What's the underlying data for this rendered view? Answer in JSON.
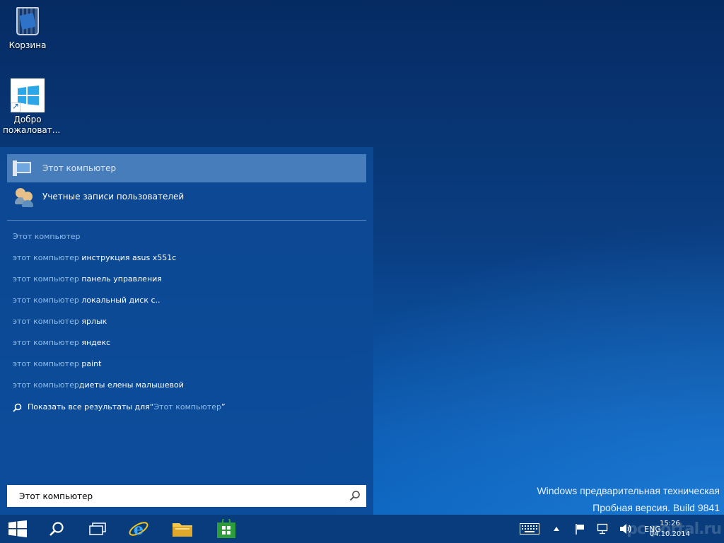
{
  "desktop": {
    "icons": [
      {
        "label": "Корзина"
      },
      {
        "label": "Добро пожаловат..."
      }
    ]
  },
  "search_panel": {
    "best_results": [
      {
        "label": "Этот компьютер",
        "selected": true,
        "icon": "computer-icon"
      },
      {
        "label": "Учетные записи пользователей",
        "selected": false,
        "icon": "user-accounts-icon"
      }
    ],
    "suggestions": [
      {
        "query": "Этот компьютер",
        "rest": ""
      },
      {
        "query": "этот компьютер",
        "rest": " инструкция asus x551c"
      },
      {
        "query": "этот компьютер",
        "rest": " панель управления"
      },
      {
        "query": "этот компьютер",
        "rest": " локальный диск с.."
      },
      {
        "query": "этот компьютер",
        "rest": " ярлык"
      },
      {
        "query": "этот компьютер",
        "rest": " яндекс"
      },
      {
        "query": "этот компьютер",
        "rest": " paint"
      },
      {
        "query": "этот компьютер",
        "rest": "диеты елены малышевой"
      }
    ],
    "show_all": {
      "prefix": "Показать все результаты для ",
      "open_quote": "“",
      "term": "Этот компьютер",
      "close_quote": "”"
    },
    "search_box": {
      "value": "Этот компьютер"
    }
  },
  "watermark": {
    "line1": "Windows предварительная техническая",
    "line2": "Пробная версия. Build 9841"
  },
  "taskbar": {
    "language": "ENG",
    "time": "15:26",
    "date": "04.10.2014",
    "brand": "pc portal.ru"
  },
  "colors": {
    "panel": "#0c4a96",
    "selected_row": "#78aadc",
    "suggestion_query": "#8fbde8",
    "taskbar": "#083a78"
  }
}
